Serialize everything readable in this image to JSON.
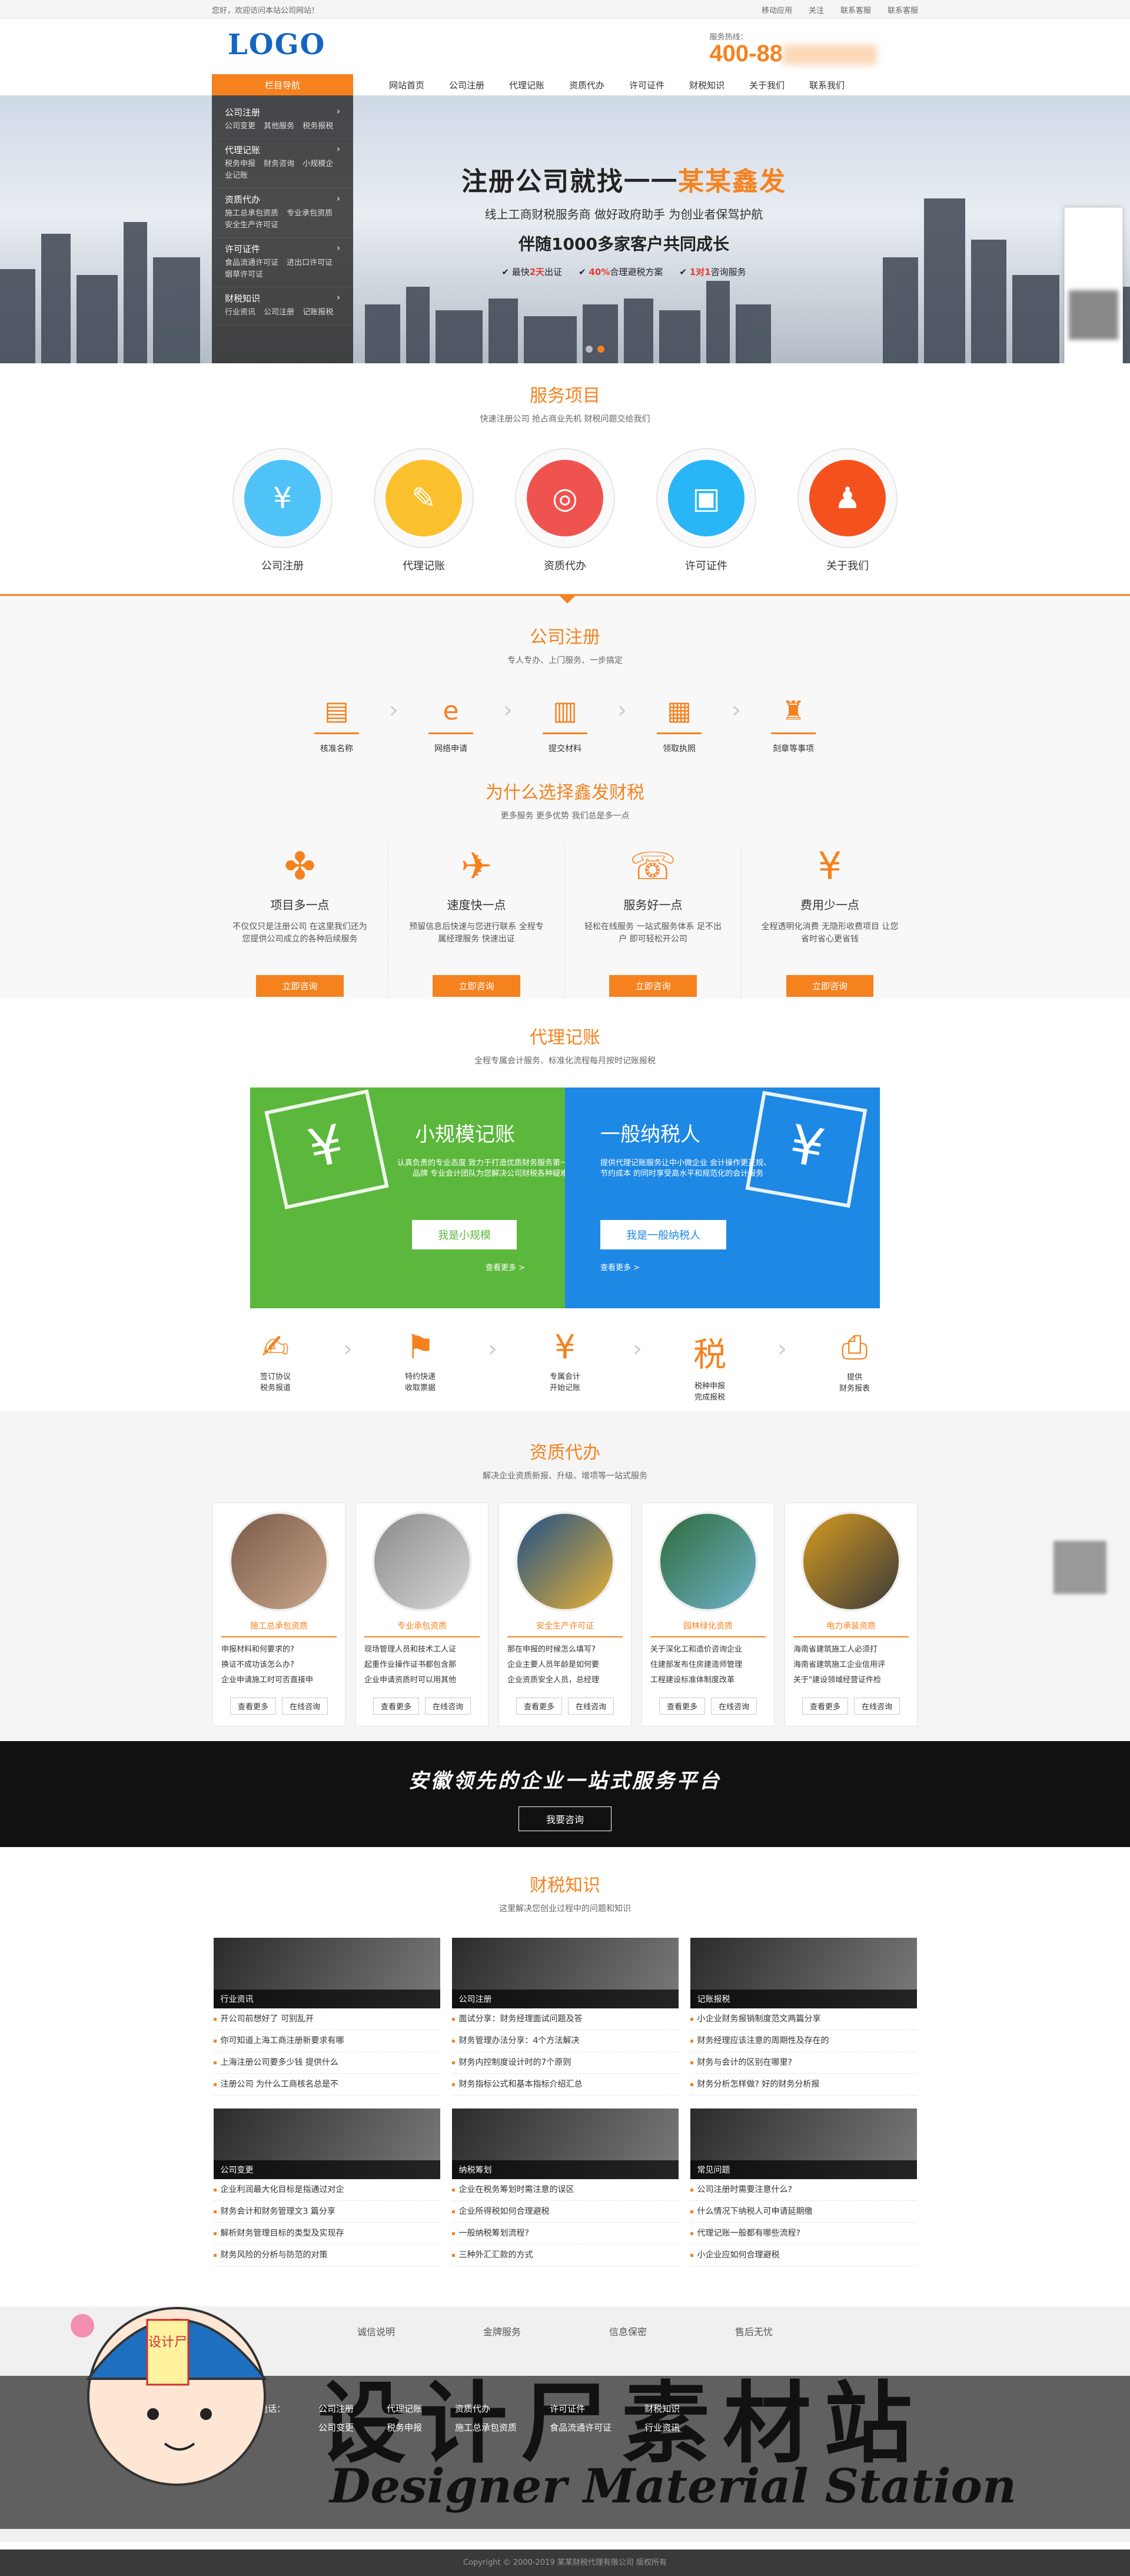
{
  "topbar": {
    "welcome": "您好，欢迎访问本站公司网站！",
    "mobile": "移动应用",
    "follow": "关注",
    "customer": "联系客服",
    "contact": "联系客服"
  },
  "header": {
    "logo": "LOGO",
    "phone_label": "服务热线：",
    "phone": "400-88"
  },
  "nav": {
    "category": "栏目导航",
    "links": [
      "网站首页",
      "公司注册",
      "代理记账",
      "资质代办",
      "许可证件",
      "财税知识",
      "关于我们",
      "联系我们"
    ]
  },
  "sidebar": [
    {
      "title": "公司注册",
      "sub": "公司变更 其他服务 税务报税"
    },
    {
      "title": "代理记账",
      "sub": "税务申报 财务咨询 小规模企业记账"
    },
    {
      "title": "资质代办",
      "sub": "施工总承包资质 专业承包资质 安全生产许可证"
    },
    {
      "title": "许可证件",
      "sub": "食品流通许可证 进出口许可证 烟草许可证"
    },
    {
      "title": "财税知识",
      "sub": "行业资讯 公司注册 记账报税"
    }
  ],
  "banner": {
    "headline": "注册公司就找一一",
    "headline_brand": "某某鑫发",
    "line2": "线上工商财税服务商 做好政府助手 为创业者保驾护航",
    "line3": "伴随1000多家客户共同成长",
    "badges": [
      {
        "pre": "最快",
        "val": "2天",
        "post": "出证"
      },
      {
        "pre": "",
        "val": "40%",
        "post": "合理避税方案"
      },
      {
        "pre": "",
        "val": "1对1",
        "post": "咨询服务"
      }
    ]
  },
  "services": {
    "title": "服务项目",
    "subtitle": "快速注册公司 抢占商业先机 财税问题交给我们",
    "items": [
      {
        "label": "公司注册",
        "color": "#4fc3f7",
        "glyph": "¥"
      },
      {
        "label": "代理记账",
        "color": "#fbc02d",
        "glyph": "✎"
      },
      {
        "label": "资质代办",
        "color": "#ef5350",
        "glyph": "◎"
      },
      {
        "label": "许可证件",
        "color": "#29b6f6",
        "glyph": "▣"
      },
      {
        "label": "关于我们",
        "color": "#f4511e",
        "glyph": "♟"
      }
    ]
  },
  "registration": {
    "title": "公司注册",
    "subtitle": "专人专办、上门服务、一步搞定",
    "steps": [
      {
        "label": "核准名称",
        "glyph": "▤"
      },
      {
        "label": "网络申请",
        "glyph": "e"
      },
      {
        "label": "提交材料",
        "glyph": "▥"
      },
      {
        "label": "领取执照",
        "glyph": "▦"
      },
      {
        "label": "刻章等事项",
        "glyph": "♜"
      }
    ]
  },
  "why": {
    "title": "为什么选择鑫发财税",
    "subtitle": "更多服务 更多优势 我们总是多一点",
    "cols": [
      {
        "glyph": "✤",
        "title": "项目多一点",
        "desc": "不仅仅只是注册公司 在这里我们还为您提供公司成立的各种后续服务",
        "btn": "立即咨询"
      },
      {
        "glyph": "✈",
        "title": "速度快一点",
        "desc": "预留信息后快速与您进行联系 全程专属经理服务 快速出证",
        "btn": "立即咨询"
      },
      {
        "glyph": "☏",
        "title": "服务好一点",
        "desc": "轻松在线服务 一站式服务体系 足不出户 即可轻松开公司",
        "btn": "立即咨询"
      },
      {
        "glyph": "¥",
        "title": "费用少一点",
        "desc": "全程透明化消费 无隐形收费项目 让您省时省心更省钱",
        "btn": "立即咨询"
      }
    ]
  },
  "agent": {
    "title": "代理记账",
    "subtitle": "全程专属会计服务、标准化流程每月按时记账报税",
    "small": {
      "title": "小规模记账",
      "desc": "认真负责的专业态度 致力于打造优质财务服务第一品牌 专业会计团队为您解决公司财税各种疑难",
      "btn": "我是小规模",
      "more": "查看更多 >"
    },
    "general": {
      "title": "一般纳税人",
      "desc": "提供代理记账服务让中小微企业 会计操作更正规、节约成本 的同时享受高水平和规范化的会计服务",
      "btn": "我是一般纳税人",
      "more": "查看更多 >"
    },
    "flow": [
      {
        "l1": "签订协议",
        "l2": "税务报道",
        "glyph": "✍"
      },
      {
        "l1": "特约快递",
        "l2": "收取票据",
        "glyph": "⚑"
      },
      {
        "l1": "专属会计",
        "l2": "开始记账",
        "glyph": "¥"
      },
      {
        "l1": "税种申报",
        "l2": "完成报税",
        "glyph": "税"
      },
      {
        "l1": "提供",
        "l2": "财务报表",
        "glyph": "⎙"
      }
    ]
  },
  "qualification": {
    "title": "资质代办",
    "subtitle": "解决企业资质新报、升级、增项等一站式服务",
    "cards": [
      {
        "title": "施工总承包资质",
        "lines": [
          "申报材料和何要求的?",
          "换证不成功该怎么办?",
          "企业申请施工时可否直接申"
        ],
        "b1": "查看更多",
        "b2": "在线咨询"
      },
      {
        "title": "专业承包资质",
        "lines": [
          "现场管理人员和技术工人证",
          "起重作业操作证书都包含那",
          "企业申请资质时可以用其他"
        ],
        "b1": "查看更多",
        "b2": "在线咨询"
      },
      {
        "title": "安全生产许可证",
        "lines": [
          "那在申报的时候怎么填写?",
          "企业主要人员年龄是如何要",
          "企业资质安全人员，总经理"
        ],
        "b1": "查看更多",
        "b2": "在线咨询"
      },
      {
        "title": "园林绿化资质",
        "lines": [
          "关于深化工和造价咨询企业",
          "住建部发布住房建造师管理",
          "工程建设标准体制度改革"
        ],
        "b1": "查看更多",
        "b2": "在线咨询"
      },
      {
        "title": "电力承装资质",
        "lines": [
          "海南省建筑施工人必须打",
          "海南省建筑施工企业信用评",
          "关于\"建设领域经营证件检"
        ],
        "b1": "查看更多",
        "b2": "在线咨询"
      }
    ]
  },
  "strip": {
    "text": "安徽领先的企业一站式服务平台",
    "btn": "我要咨询"
  },
  "knowledge": {
    "title": "财税知识",
    "subtitle": "这里解决您创业过程中的问题和知识",
    "boxes": [
      {
        "label": "行业资讯",
        "items": [
          "开公司前想好了 可别乱开",
          "你可知道上海工商注册新要求有哪",
          "上海注册公司要多少钱 提供什么",
          "注册公司 为什么工商核名总是不"
        ]
      },
      {
        "label": "公司注册",
        "items": [
          "面试分享：财务经理面试问题及答",
          "财务管理办法分享：4个方法解决",
          "财务内控制度设计时的7个原则",
          "财务指标公式和基本指标介绍汇总"
        ]
      },
      {
        "label": "记账报税",
        "items": [
          "小企业财务报销制度范文两篇分享",
          "财务经理应该注意的周期性及存在的",
          "财务与会计的区别在哪里?",
          "财务分析怎样做? 好的财务分析报"
        ]
      },
      {
        "label": "公司变更",
        "items": [
          "企业利润最大化目标是指通过对企",
          "财务会计和财务管理文3 篇分享",
          "解析财务管理目标的类型及实现存",
          "财务风险的分析与防范的对策"
        ]
      },
      {
        "label": "纳税筹划",
        "items": [
          "企业在税务筹划时需注意的误区",
          "企业所得税如何合理避税",
          "一般纳税筹划流程?",
          "三种外汇汇款的方式"
        ]
      },
      {
        "label": "常见问题",
        "items": [
          "公司注册时需要注意什么?",
          "什么情况下纳税人可申请延期缴",
          "代理记账一般都有哪些流程?",
          "小企业应如何合理避税"
        ]
      }
    ]
  },
  "footer": {
    "features": [
      "诚信说明",
      "金牌服务",
      "信息保密",
      "售后无忧"
    ],
    "phone_label": "电话：",
    "menus": [
      {
        "title": "公司注册",
        "items": [
          "公司变更"
        ]
      },
      {
        "title": "代理记账",
        "items": [
          "税务申报"
        ]
      },
      {
        "title": "资质代办",
        "items": [
          "施工总承包资质"
        ]
      },
      {
        "title": "许可证件",
        "items": [
          "食品流通许可证"
        ]
      },
      {
        "title": "财税知识",
        "items": [
          "行业资讯"
        ]
      }
    ],
    "copyright": "Copyright © 2000-2019 某某财税代理有限公司 版权所有"
  },
  "watermark": {
    "cn": "设计尸素材站",
    "en": "Designer Material Station",
    "badge": "设计尸"
  }
}
